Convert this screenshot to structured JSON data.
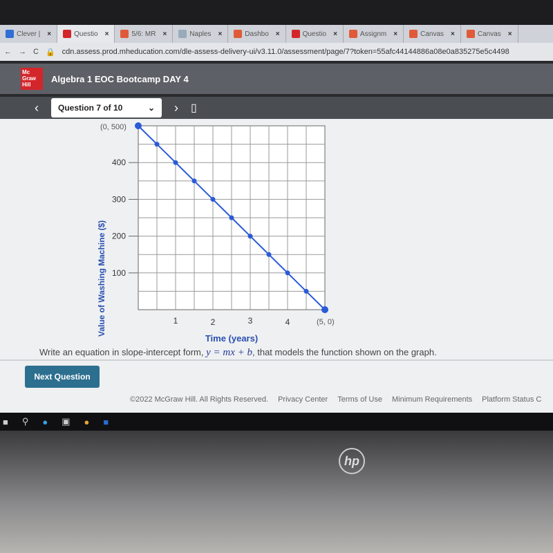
{
  "browser": {
    "tabs": [
      {
        "label": "Clever |",
        "color": "#2f6fd6"
      },
      {
        "label": "Questio",
        "color": "#d3262b"
      },
      {
        "label": "5/6: MR",
        "color": "#e05a3a"
      },
      {
        "label": "Naples",
        "color": "#9ab"
      },
      {
        "label": "Dashbo",
        "color": "#e05a3a"
      },
      {
        "label": "Questio",
        "color": "#d3262b"
      },
      {
        "label": "Assignm",
        "color": "#e05a3a"
      },
      {
        "label": "Canvas",
        "color": "#e05a3a"
      },
      {
        "label": "Canvas",
        "color": "#e05a3a"
      }
    ],
    "url": "cdn.assess.prod.mheducation.com/dle-assess-delivery-ui/v3.11.0/assessment/page/7?token=55afc44144886a08e0a835275e5c4498"
  },
  "header": {
    "logo": "Mc Graw Hill",
    "title": "Algebra 1 EOC Bootcamp DAY 4"
  },
  "question_nav": {
    "selector": "Question 7 of 10"
  },
  "chart_data": {
    "type": "line",
    "xlabel": "Time (years)",
    "ylabel": "Value of Washing Machine ($)",
    "x_ticks": [
      "1",
      "2",
      "3",
      "4"
    ],
    "y_ticks": [
      "100",
      "200",
      "300",
      "400"
    ],
    "xlim": [
      0,
      5
    ],
    "ylim": [
      0,
      500
    ],
    "grid": true,
    "points": [
      [
        0,
        500
      ],
      [
        0.5,
        450
      ],
      [
        1,
        400
      ],
      [
        1.5,
        350
      ],
      [
        2,
        300
      ],
      [
        2.5,
        250
      ],
      [
        3,
        200
      ],
      [
        3.5,
        150
      ],
      [
        4,
        100
      ],
      [
        4.5,
        50
      ],
      [
        5,
        0
      ]
    ],
    "annotations": [
      {
        "text": "(0, 500)"
      },
      {
        "text": "(5, 0)"
      }
    ],
    "color": "#2a5bd7"
  },
  "question": {
    "prompt_pre": "Write an equation in slope-intercept form, ",
    "equation": "y = mx + b",
    "prompt_post": ", that models the function shown on the graph."
  },
  "next_label": "Next Question",
  "footer": [
    "©2022 McGraw Hill. All Rights Reserved.",
    "Privacy Center",
    "Terms of Use",
    "Minimum Requirements",
    "Platform Status C"
  ],
  "device_logo": "hp"
}
